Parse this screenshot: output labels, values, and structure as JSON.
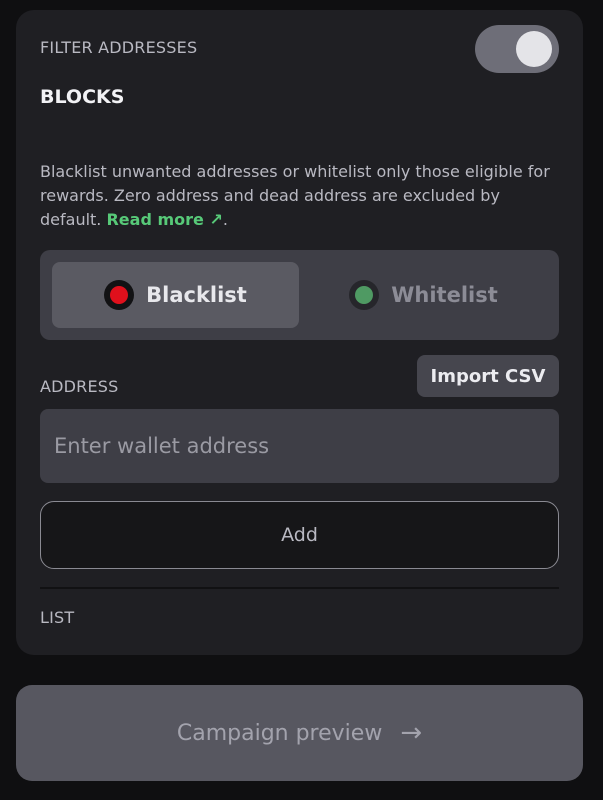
{
  "filter": {
    "label": "FILTER ADDRESSES",
    "toggle_on": true
  },
  "blocks": {
    "title": "BLOCKS",
    "description": "Blacklist unwanted addresses or whitelist only those eligible for rewards. Zero address and dead address are excluded by default. ",
    "read_more": "Read more",
    "read_more_icon": "↗",
    "period": "."
  },
  "mode": {
    "options": [
      {
        "label": "Blacklist",
        "selected": true,
        "color": "#e0101c"
      },
      {
        "label": "Whitelist",
        "selected": false,
        "color": "#4f9a63"
      }
    ]
  },
  "address": {
    "label": "ADDRESS",
    "import_label": "Import CSV",
    "placeholder": "Enter wallet address",
    "value": "",
    "add_label": "Add"
  },
  "list": {
    "label": "LIST"
  },
  "footer": {
    "preview_label": "Campaign preview",
    "arrow": "→"
  },
  "colors": {
    "accent_link": "#57c978",
    "card_bg": "#1f1f23",
    "page_bg": "#0f0f11"
  }
}
